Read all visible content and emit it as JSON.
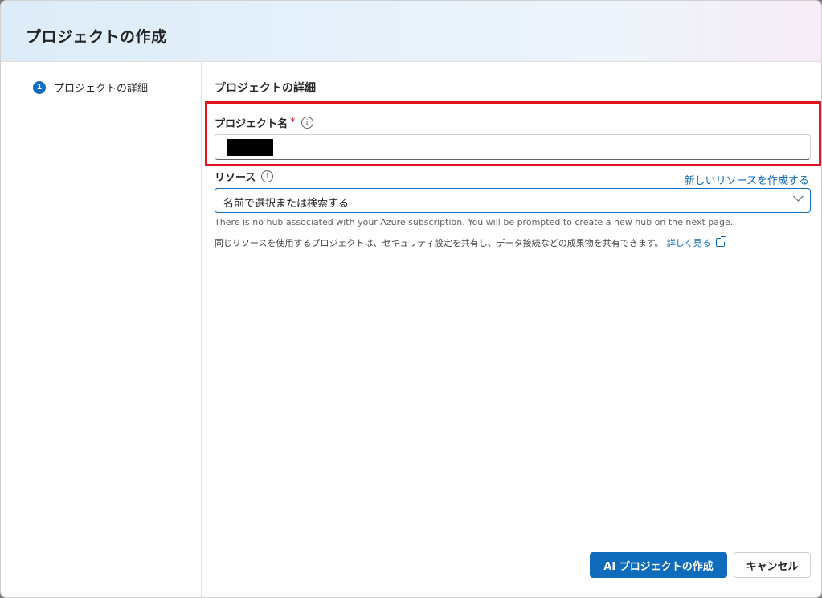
{
  "dialog": {
    "title": "プロジェクトの作成"
  },
  "steps": [
    {
      "number": "1",
      "label": "プロジェクトの詳細"
    }
  ],
  "form": {
    "section_title": "プロジェクトの詳細",
    "project_name": {
      "label": "プロジェクト名",
      "required_marker": "*",
      "info_icon": "info-icon",
      "value_redacted": true
    },
    "resource": {
      "label": "リソース",
      "info_icon": "info-icon",
      "create_link": "新しいリソースを作成する",
      "placeholder": "名前で選択または検索する",
      "hint": "There is no hub associated with your Azure subscription. You will be prompted to create a new hub on the next page.",
      "description": "同じリソースを使用するプロジェクトは、セキュリティ設定を共有し、データ接続などの成果物を共有できます。",
      "learn_more": "詳しく見る",
      "learn_more_icon": "external-link-icon"
    }
  },
  "footer": {
    "create_button": "AI プロジェクトの作成",
    "cancel_button": "キャンセル"
  },
  "colors": {
    "accent": "#0f6cbd",
    "highlight_border": "#e0161e",
    "required": "#c50f1f"
  }
}
